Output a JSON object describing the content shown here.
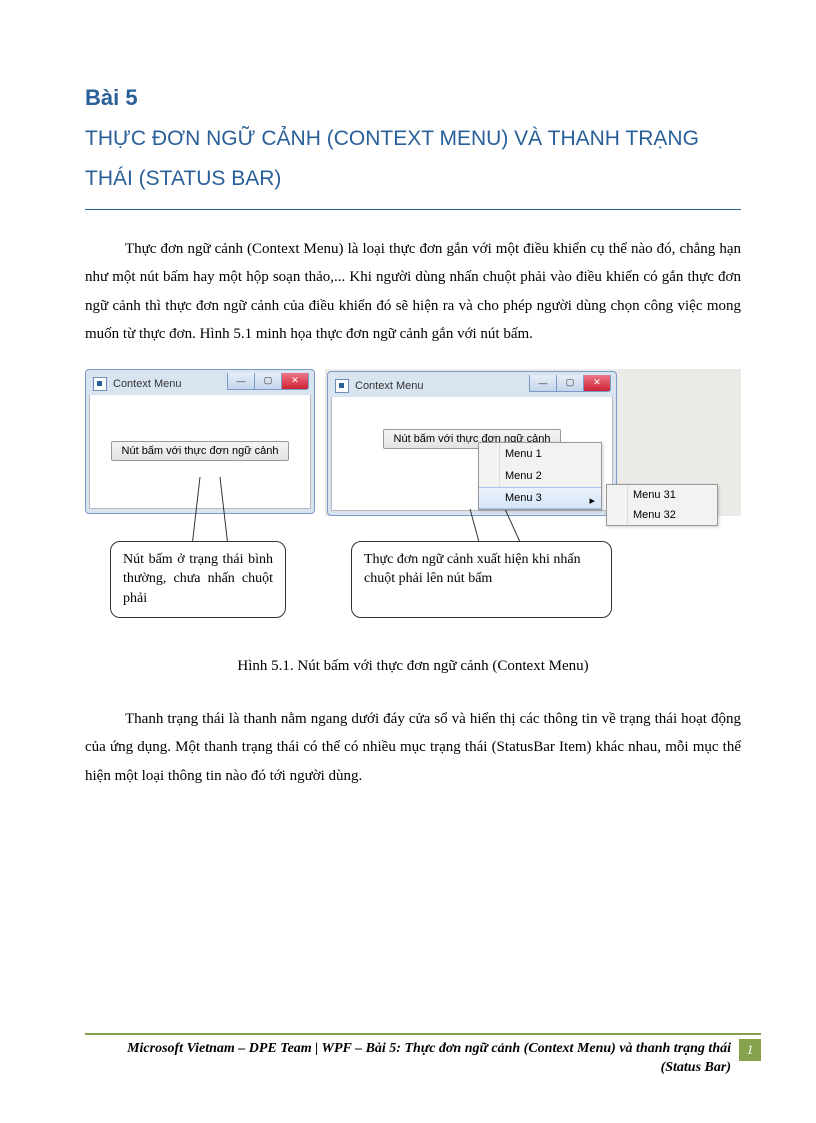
{
  "lesson_num": "Bài 5",
  "title": "THỰC ĐƠN NGỮ CẢNH (CONTEXT MENU) VÀ THANH TRẠNG THÁI (STATUS BAR)",
  "para1": "Thực đơn ngữ cảnh (Context Menu) là loại thực đơn gắn với một điều khiển cụ thể nào đó, chẳng hạn như một nút bấm hay một hộp soạn thảo,... Khi người dùng nhấn chuột phải vào điều khiển có gắn thực đơn ngữ cảnh thì thực đơn ngữ cảnh của điều khiển đó sẽ hiện ra và cho phép người dùng chọn công việc mong muốn từ thực đơn. Hình 5.1 minh họa thực đơn ngữ cảnh gắn với nút bấm.",
  "win_title": "Context Menu",
  "button_label": "Nút bấm với thực đơn ngữ cảnh",
  "menu": {
    "items": [
      "Menu 1",
      "Menu 2",
      "Menu 3"
    ],
    "sub": [
      "Menu 31",
      "Menu 32"
    ]
  },
  "callout1": "Nút bấm ở trạng thái bình thường, chưa nhấn chuột phải",
  "callout2": "Thực đơn ngữ cảnh xuất hiện khi nhấn chuột phải lên nút bấm",
  "caption": "Hình 5.1. Nút bấm với thực đơn ngữ cảnh (Context Menu)",
  "para2": "Thanh trạng thái là thanh nằm ngang dưới đáy cửa sổ và hiển thị các thông tin về trạng thái hoạt động của ứng dụng. Một thanh trạng thái có thể có nhiều mục trạng thái (StatusBar Item)  khác nhau, mỗi mục thể hiện một loại thông tin nào đó tới người dùng.",
  "footer_text": "Microsoft Vietnam – DPE Team | WPF – Bài 5: Thực đơn ngữ cảnh (Context Menu) và thanh trạng thái (Status Bar)",
  "page_num": "1"
}
